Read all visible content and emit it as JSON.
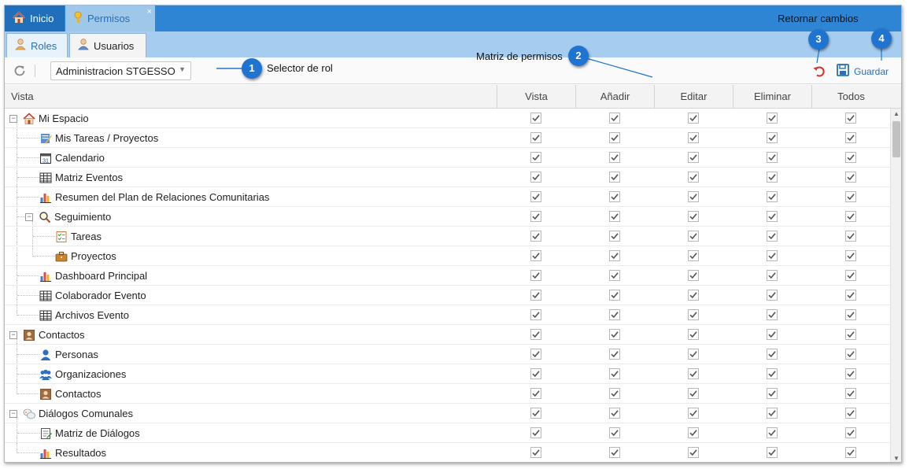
{
  "tabs": {
    "inicio": "Inicio",
    "permisos": "Permisos",
    "close_glyph": "×"
  },
  "subtabs": {
    "roles": "Roles",
    "usuarios": "Usuarios"
  },
  "toolbar": {
    "role_value": "Administracion STGESSO",
    "save_label": "Guardar"
  },
  "columns": [
    "Vista",
    "Añadir",
    "Editar",
    "Eliminar",
    "Todos"
  ],
  "first_column": "Vista",
  "rows": [
    {
      "label": "Mi Espacio",
      "level": 0,
      "icon": "home-icon",
      "toggle": "−"
    },
    {
      "label": "Mis Tareas / Proyectos",
      "level": 1,
      "icon": "edit-task-icon"
    },
    {
      "label": "Calendario",
      "level": 1,
      "icon": "calendar-icon"
    },
    {
      "label": "Matriz Eventos",
      "level": 1,
      "icon": "table-icon"
    },
    {
      "label": "Resumen del Plan de Relaciones Comunitarias",
      "level": 1,
      "icon": "bar-chart-icon"
    },
    {
      "label": "Seguimiento",
      "level": 1,
      "icon": "magnifier-icon",
      "toggle": "−"
    },
    {
      "label": "Tareas",
      "level": 2,
      "icon": "task-list-icon"
    },
    {
      "label": "Proyectos",
      "level": 2,
      "icon": "briefcase-icon"
    },
    {
      "label": "Dashboard Principal",
      "level": 1,
      "icon": "bar-chart-icon"
    },
    {
      "label": "Colaborador Evento",
      "level": 1,
      "icon": "table-icon"
    },
    {
      "label": "Archivos Evento",
      "level": 1,
      "icon": "table-icon"
    },
    {
      "label": "Contactos",
      "level": 0,
      "icon": "contact-card-icon",
      "toggle": "−"
    },
    {
      "label": "Personas",
      "level": 1,
      "icon": "person-icon"
    },
    {
      "label": "Organizaciones",
      "level": 1,
      "icon": "group-icon"
    },
    {
      "label": "Contactos",
      "level": 1,
      "icon": "contact-card-icon"
    },
    {
      "label": "Diálogos Comunales",
      "level": 0,
      "icon": "dialog-icon",
      "toggle": "−"
    },
    {
      "label": "Matriz de Diálogos",
      "level": 1,
      "icon": "document-icon"
    },
    {
      "label": "Resultados",
      "level": 1,
      "icon": "bar-chart-icon"
    }
  ],
  "permissions_all_checked": true,
  "callouts": [
    {
      "number": "1",
      "text": "Selector de rol"
    },
    {
      "number": "2",
      "text": "Matriz de permisos"
    },
    {
      "number": "3",
      "text": "Retornar cambios"
    },
    {
      "number": "4",
      "text": ""
    }
  ],
  "colors": {
    "topbar": "#2d85d3",
    "subbar": "#a6cdef",
    "accent": "#2a6fb5",
    "callout": "#1f74d2",
    "undo": "#d9302b"
  }
}
